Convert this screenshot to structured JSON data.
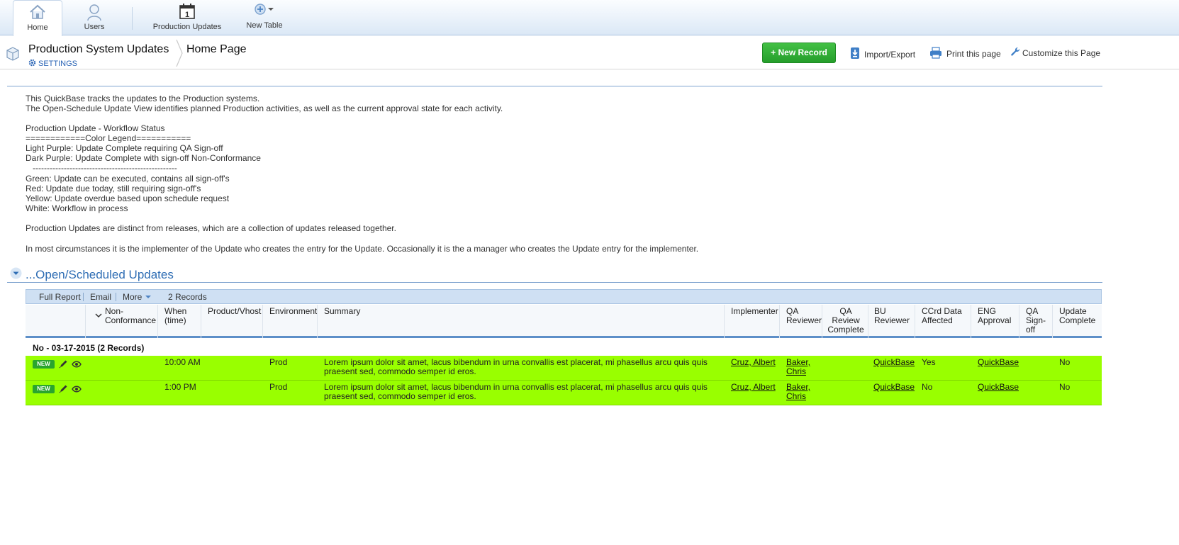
{
  "nav": {
    "tabs": [
      {
        "label": "Home",
        "icon": "home-icon"
      },
      {
        "label": "Users",
        "icon": "user-icon"
      },
      {
        "label": "Production Updates",
        "icon": "calendar-icon"
      },
      {
        "label": "New Table",
        "icon": "add-circle-icon"
      }
    ],
    "calendar_day": "1"
  },
  "header": {
    "app_title": "Production System Updates",
    "settings": "SETTINGS",
    "page_title": "Home Page",
    "new_record": "+ New Record",
    "import_export": "Import/Export",
    "print": "Print this page",
    "customize": "Customize this Page"
  },
  "description": {
    "intro1": "This QuickBase tracks the updates to the Production systems.",
    "intro2": "The Open-Schedule Update View identifies planned Production activities, as well as the current approval state for each activity.",
    "workflow_title": "Production Update - Workflow Status",
    "legend_title": "============Color Legend===========",
    "light_purple": "Light Purple: Update Complete requiring QA Sign-off",
    "dark_purple": "Dark Purple: Update Complete with sign-off Non-Conformance",
    "divider": "   ---------------------------------------------------",
    "green": "Green: Update can be executed, contains all sign-off's",
    "red": "Red: Update due today, still requiring sign-off's",
    "yellow": "Yellow: Update overdue based upon schedule request",
    "white": "White: Workflow in process",
    "releases": "Production Updates are distinct from releases, which are a collection of updates released together.",
    "circumstances": "In most circumstances it is the implementer of the Update who creates the entry for the Update. Occasionally it is the a manager who creates the Update entry for the implementer."
  },
  "report": {
    "title": "...Open/Scheduled Updates",
    "toolbar": {
      "full_report": "Full Report",
      "email": "Email",
      "more": "More",
      "count": "2 Records"
    },
    "columns": {
      "non_conformance": "Non-\nConformance",
      "when": "When\n(time)",
      "product": "Product/Vhost",
      "environment": "Environment",
      "summary": "Summary",
      "implementer": "Implementer",
      "qa_reviewer": "QA\nReviewer",
      "qa_review_complete": "QA\nReview\nComplete",
      "bu_reviewer": "BU\nReviewer",
      "ccrd": "CCrd Data\nAffected",
      "eng": "ENG\nApproval",
      "qa_signoff": "QA\nSign-\noff",
      "update_complete": "Update\nComplete"
    },
    "group_label": "No - 03-17-2015  (2 Records)",
    "badge": "NEW",
    "row_color": "#99ff00",
    "rows": [
      {
        "when": "10:00 AM",
        "environment": "Prod",
        "summary": "Lorem ipsum dolor sit amet, lacus bibendum in urna convallis est placerat, mi phasellus arcu quis quis\npraesent sed, commodo semper id eros.",
        "implementer": "Cruz, Albert",
        "qa_reviewer": "Baker,\nChris",
        "bu_reviewer": "QuickBase",
        "ccrd": "Yes",
        "eng": "QuickBase",
        "update_complete": "No"
      },
      {
        "when": "1:00 PM",
        "environment": "Prod",
        "summary": "Lorem ipsum dolor sit amet, lacus bibendum in urna convallis est placerat, mi phasellus arcu quis quis\npraesent sed, commodo semper id eros.",
        "implementer": "Cruz, Albert",
        "qa_reviewer": "Baker,\nChris",
        "bu_reviewer": "QuickBase",
        "ccrd": "No",
        "eng": "QuickBase",
        "update_complete": "No"
      }
    ]
  }
}
